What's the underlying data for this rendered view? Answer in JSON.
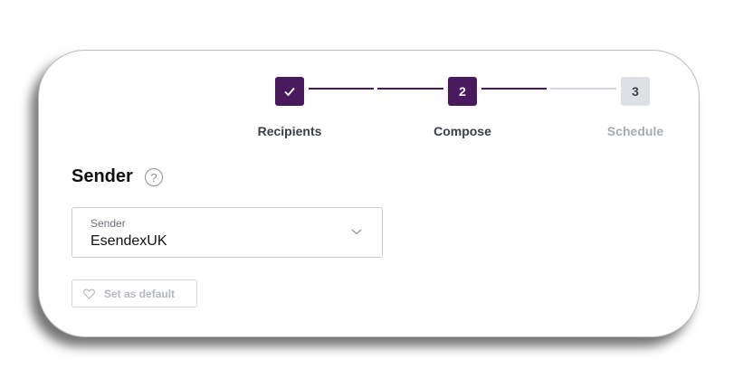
{
  "stepper": {
    "steps": [
      {
        "label": "Recipients",
        "number": "",
        "state": "completed",
        "icon": "check-icon"
      },
      {
        "label": "Compose",
        "number": "2",
        "state": "active"
      },
      {
        "label": "Schedule",
        "number": "3",
        "state": "upcoming"
      }
    ]
  },
  "sender_section": {
    "title": "Sender",
    "help_icon": "?"
  },
  "sender_select": {
    "label": "Sender",
    "value": "EsendexUK",
    "icon": "chevron-down-icon"
  },
  "default_button": {
    "label": "Set as default",
    "icon": "heart-icon"
  },
  "colors": {
    "accent": "#4a1a5e",
    "inactive": "#dde0e5",
    "text": "#3a3f47",
    "muted": "#a7abb2"
  }
}
